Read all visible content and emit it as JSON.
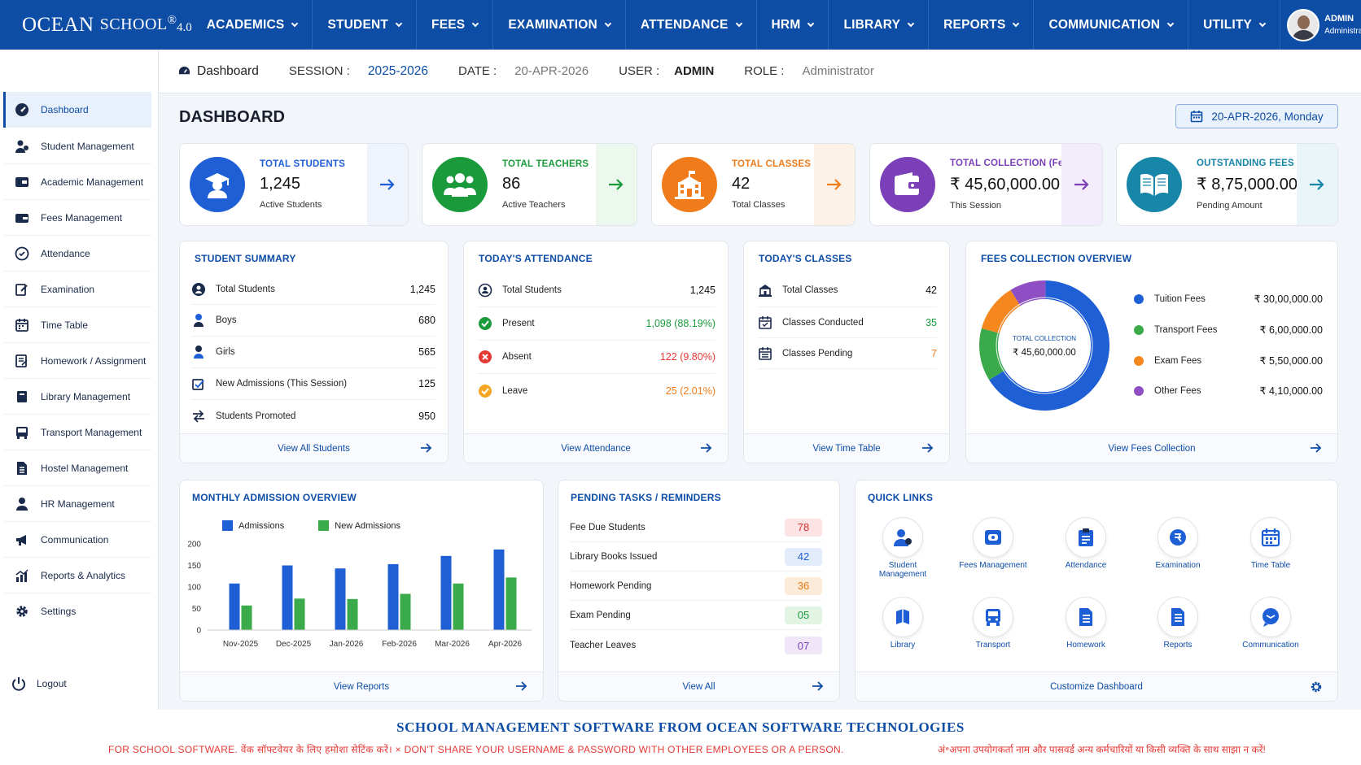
{
  "brand": {
    "name1": "OCEAN",
    "name2": "SCHOOL",
    "reg": "®",
    "version": "4.0"
  },
  "menu": [
    {
      "label": "ACADEMICS"
    },
    {
      "label": "STUDENT"
    },
    {
      "label": "FEES"
    },
    {
      "label": "EXAMINATION"
    },
    {
      "label": "ATTENDANCE"
    },
    {
      "label": "HRM"
    },
    {
      "label": "LIBRARY"
    },
    {
      "label": "REPORTS"
    },
    {
      "label": "COMMUNICATION"
    },
    {
      "label": "UTILITY"
    }
  ],
  "user": {
    "name": "ADMIN",
    "role": "Administrator"
  },
  "subheader": {
    "page": "Dashboard",
    "session_label": "SESSION :",
    "session": "2025-2026",
    "date_label": "DATE :",
    "date": "20-APR-2026",
    "user_label": "USER :",
    "user": "ADMIN",
    "role_label": "ROLE :",
    "role": "Administrator"
  },
  "sidebar": [
    {
      "label": "Dashboard"
    },
    {
      "label": "Student Management"
    },
    {
      "label": "Academic Management"
    },
    {
      "label": "Fees Management"
    },
    {
      "label": "Attendance"
    },
    {
      "label": "Examination"
    },
    {
      "label": "Time Table"
    },
    {
      "label": "Homework / Assignment"
    },
    {
      "label": "Library Management"
    },
    {
      "label": "Transport Management"
    },
    {
      "label": "Hostel Management"
    },
    {
      "label": "HR Management"
    },
    {
      "label": "Communication"
    },
    {
      "label": "Reports & Analytics"
    },
    {
      "label": "Settings"
    }
  ],
  "logout": "Logout",
  "dashboard": {
    "title": "DASHBOARD",
    "date_button": "20-APR-2026, Monday"
  },
  "stats": [
    {
      "title": "TOTAL STUDENTS",
      "value": "1,245",
      "sub": "Active Students",
      "color": "#1f5fd6"
    },
    {
      "title": "TOTAL TEACHERS",
      "value": "86",
      "sub": "Active Teachers",
      "color": "#1b9a3c"
    },
    {
      "title": "TOTAL CLASSES",
      "value": "42",
      "sub": "Total Classes",
      "color": "#f07b1a"
    },
    {
      "title": "TOTAL COLLECTION (Fees)",
      "value": "₹ 45,60,000.00",
      "sub": "This Session",
      "color": "#7b3fb8"
    },
    {
      "title": "OUTSTANDING FEES",
      "value": "₹ 8,75,000.00",
      "sub": "Pending Amount",
      "color": "#1786a8"
    }
  ],
  "student_summary": {
    "title": "STUDENT SUMMARY",
    "rows": [
      {
        "label": "Total Students",
        "value": "1,245"
      },
      {
        "label": "Boys",
        "value": "680"
      },
      {
        "label": "Girls",
        "value": "565"
      },
      {
        "label": "New Admissions (This Session)",
        "value": "125"
      },
      {
        "label": "Students Promoted",
        "value": "950"
      }
    ],
    "footer": "View All Students"
  },
  "attendance": {
    "title": "TODAY'S ATTENDANCE",
    "rows": [
      {
        "label": "Total Students",
        "value": "1,245"
      },
      {
        "label": "Present",
        "value": "1,098 (88.19%)"
      },
      {
        "label": "Absent",
        "value": "122 (9.80%)"
      },
      {
        "label": "Leave",
        "value": "25 (2.01%)"
      }
    ],
    "footer": "View Attendance"
  },
  "classes": {
    "title": "TODAY'S CLASSES",
    "rows": [
      {
        "label": "Total Classes",
        "value": "42"
      },
      {
        "label": "Classes Conducted",
        "value": "35"
      },
      {
        "label": "Classes Pending",
        "value": "7"
      }
    ],
    "footer": "View Time Table"
  },
  "fees_overview": {
    "title": "FEES COLLECTION OVERVIEW",
    "center_label": "TOTAL COLLECTION",
    "center_value": "₹ 45,60,000.00",
    "items": [
      {
        "label": "Tuition Fees",
        "value": "₹ 30,00,000.00",
        "amount": 3000000,
        "color": "#1f5fd6"
      },
      {
        "label": "Transport Fees",
        "value": "₹ 6,00,000.00",
        "amount": 600000,
        "color": "#3aaa4a"
      },
      {
        "label": "Exam Fees",
        "value": "₹ 5,50,000.00",
        "amount": 550000,
        "color": "#f5871f"
      },
      {
        "label": "Other Fees",
        "value": "₹ 4,10,000.00",
        "amount": 410000,
        "color": "#8e4fc4"
      }
    ],
    "footer": "View Fees Collection"
  },
  "chart_data": {
    "type": "bar",
    "title": "MONTHLY ADMISSION OVERVIEW",
    "categories": [
      "Nov-2025",
      "Dec-2025",
      "Jan-2026",
      "Feb-2026",
      "Mar-2026",
      "Apr-2026"
    ],
    "series": [
      {
        "name": "Admissions",
        "values": [
          108,
          150,
          143,
          153,
          172,
          187
        ],
        "color": "#1f5fd6"
      },
      {
        "name": "New Admissions",
        "values": [
          57,
          73,
          72,
          84,
          108,
          122
        ],
        "color": "#3aaa4a"
      }
    ],
    "yticks": [
      "0",
      "50",
      "100",
      "150",
      "200"
    ],
    "ylim": [
      0,
      200
    ],
    "legend": "top-left",
    "footer": "View Reports"
  },
  "pending": {
    "title": "PENDING TASKS / REMINDERS",
    "rows": [
      {
        "label": "Fee Due Students",
        "value": "78",
        "bg": "#fde3e3",
        "fg": "#d32f2f"
      },
      {
        "label": "Library Books Issued",
        "value": "42",
        "bg": "#e3ecfb",
        "fg": "#1f5fd6"
      },
      {
        "label": "Homework Pending",
        "value": "36",
        "bg": "#fdebd9",
        "fg": "#e07b10"
      },
      {
        "label": "Exam Pending",
        "value": "05",
        "bg": "#e2f4e4",
        "fg": "#1b9a3c"
      },
      {
        "label": "Teacher Leaves",
        "value": "07",
        "bg": "#efe6f8",
        "fg": "#7b3fb8"
      }
    ],
    "footer": "View All"
  },
  "quick_links": {
    "title": "QUICK LINKS",
    "items": [
      {
        "label": "Student Management"
      },
      {
        "label": "Fees Management"
      },
      {
        "label": "Attendance"
      },
      {
        "label": "Examination"
      },
      {
        "label": "Time Table"
      },
      {
        "label": "Library"
      },
      {
        "label": "Transport"
      },
      {
        "label": "Homework"
      },
      {
        "label": "Reports"
      },
      {
        "label": "Communication"
      }
    ],
    "footer": "Customize Dashboard"
  },
  "footer": {
    "headline": "SCHOOL MANAGEMENT SOFTWARE FROM OCEAN SOFTWARE TECHNOLOGIES",
    "warning_left": "FOR SCHOOL SOFTWARE. वेंक सॉफ्टवेयर के लिए हमोशा सेटिंक करें। × DON'T SHARE YOUR USERNAME & PASSWORD WITH OTHER EMPLOYEES OR A PERSON.",
    "warning_right": "अं॰अपना उपयोगकर्ता नाम और पासवर्ड अन्य कर्मचारियों या किसी व्यक्ति के साथ साझा न करें!"
  }
}
